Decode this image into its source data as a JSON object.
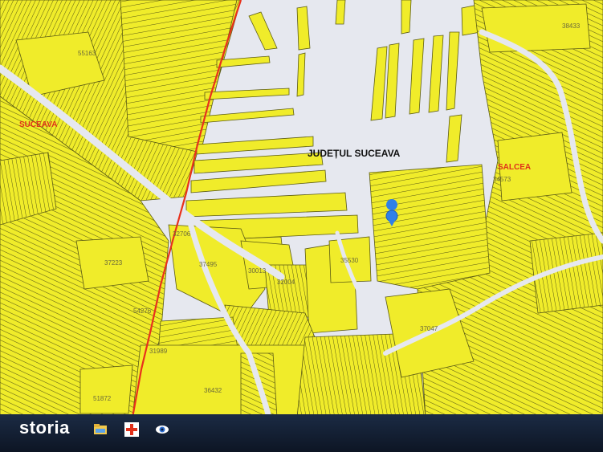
{
  "map": {
    "county_label": "JUDEȚUL SUCEAVA",
    "localities": {
      "west": "SUCEAVA",
      "east": "SALCEA"
    },
    "parcel_numbers": {
      "p55163": "55163",
      "p38433": "38433",
      "p34573": "34573",
      "p32706": "32706",
      "p37223": "37223",
      "p37495": "37495",
      "p30013": "30013",
      "p35530": "35530",
      "p32004": "32004",
      "p54276": "54276",
      "p37047": "37047",
      "p31989": "31989",
      "p36432": "36432",
      "p51872": "51872"
    },
    "colors": {
      "parcel_fill": "#f0ec2a",
      "parcel_stroke": "#5a5a14",
      "background": "#e6e8ef",
      "boundary_line": "#e8311c",
      "location_pin": "#2f80e8"
    },
    "marker_icon": "location-pin-icon"
  },
  "taskbar": {
    "brand": "storia",
    "icons": [
      "folder-icon",
      "red-cross-icon",
      "eye-icon"
    ]
  }
}
